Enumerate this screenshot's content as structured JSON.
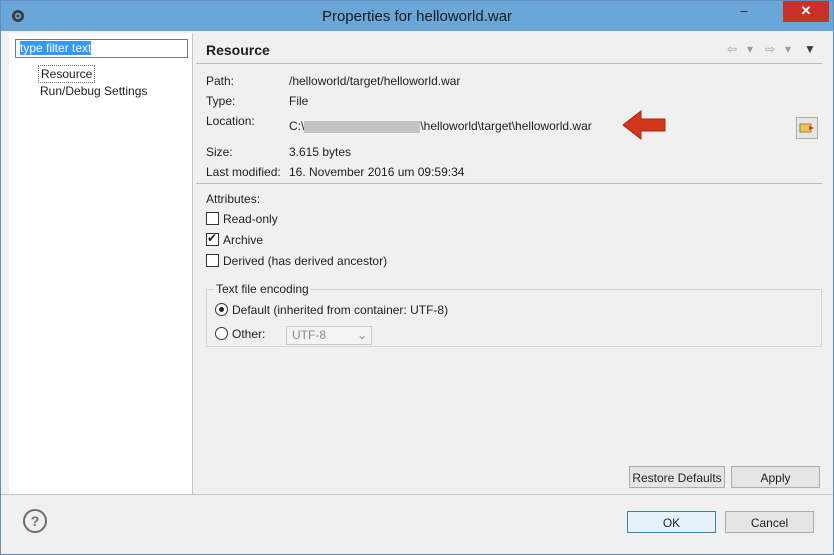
{
  "window": {
    "title": "Properties for helloworld.war"
  },
  "titlebar": {
    "minimize": "–",
    "close": "✕"
  },
  "filter": {
    "placeholder": "type filter text"
  },
  "tree": {
    "items": [
      "Resource",
      "Run/Debug Settings"
    ]
  },
  "page": {
    "title": "Resource"
  },
  "nav": {
    "back": "⇦",
    "forward": "⇨",
    "dropdown": "▾",
    "menu": "▼"
  },
  "info": {
    "path_label": "Path:",
    "path_value": "/helloworld/target/helloworld.war",
    "type_label": "Type:",
    "type_value": "File",
    "location_label": "Location:",
    "location_prefix": "C:\\",
    "location_suffix": "\\helloworld\\target\\helloworld.war",
    "size_label": "Size:",
    "size_value": "3.615  bytes",
    "modified_label": "Last modified:",
    "modified_value": "16. November 2016 um 09:59:34"
  },
  "attributes": {
    "label": "Attributes:",
    "read_only": "Read-only",
    "read_only_checked": false,
    "archive": "Archive",
    "archive_checked": true,
    "derived": "Derived (has derived ancestor)",
    "derived_checked": false
  },
  "encoding": {
    "group_label": "Text file encoding",
    "default_option": "Default (inherited from container: UTF-8)",
    "other_option": "Other:",
    "other_value": "UTF-8",
    "selected": "default"
  },
  "buttons": {
    "restore_defaults": "Restore Defaults",
    "apply": "Apply",
    "ok": "OK",
    "cancel": "Cancel",
    "help": "?"
  },
  "icons": {
    "app": "gear-icon",
    "open_location": "folder-open-icon",
    "callout_arrow": "red-arrow-icon",
    "help": "help-icon"
  },
  "colors": {
    "titlebar": "#6aa6d8",
    "close": "#c7312b",
    "selection": "#3399ff",
    "callout_arrow": "#d4361c"
  }
}
